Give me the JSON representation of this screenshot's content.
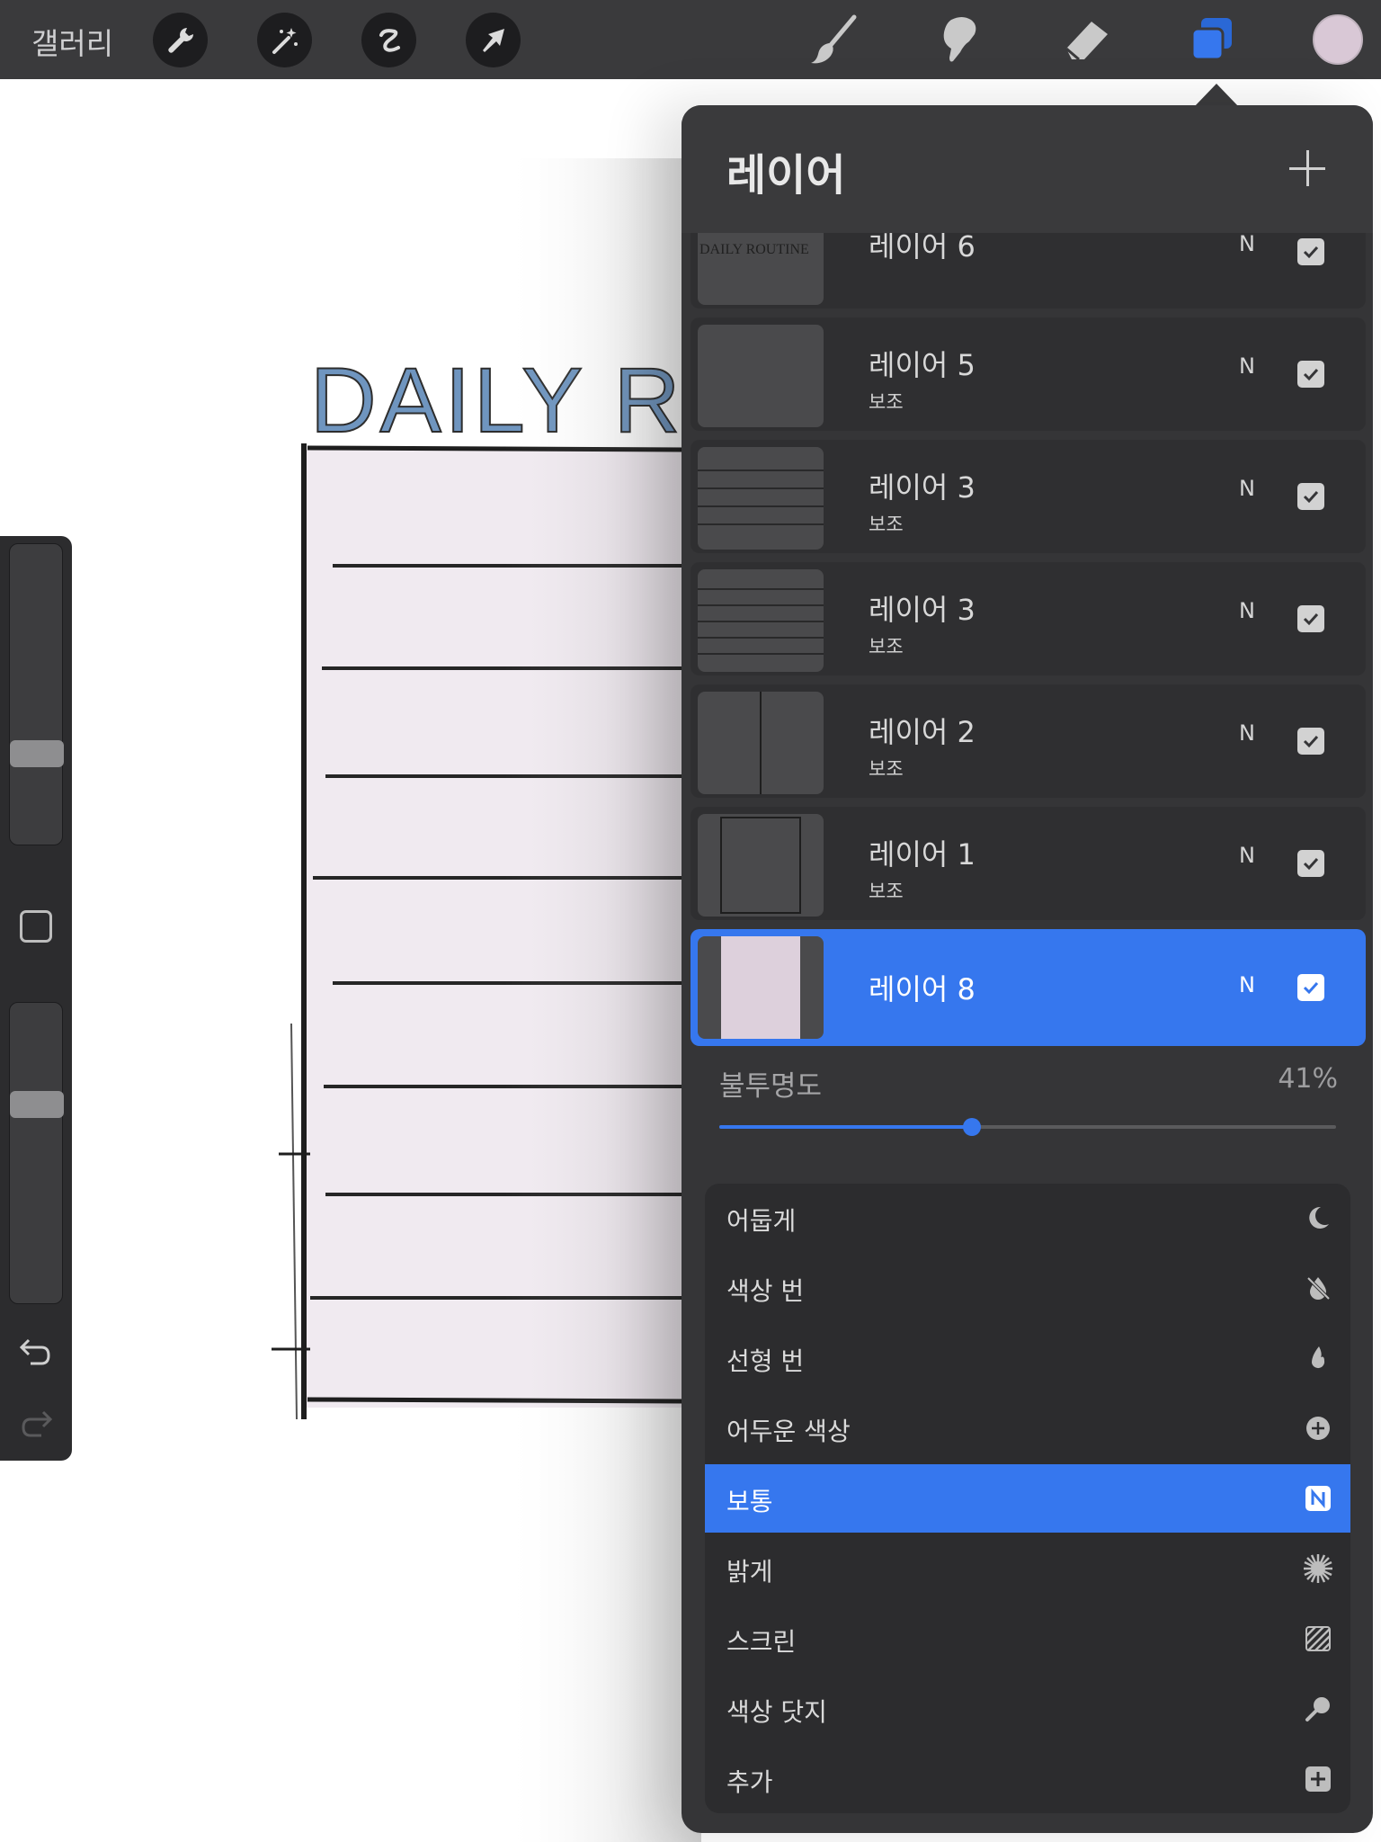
{
  "toolbar": {
    "gallery_label": "갤러리",
    "left_tools": [
      "wrench-icon",
      "magic-wand-icon",
      "selection-icon",
      "transform-arrow-icon"
    ],
    "right_tools": [
      "brush-icon",
      "smudge-icon",
      "eraser-icon",
      "layers-icon"
    ],
    "color_swatch": "#d9c8d6",
    "accent_color": "#3677ee"
  },
  "canvas": {
    "title_text": "DAILY RO"
  },
  "layers_panel": {
    "title": "레이어",
    "layers": [
      {
        "name": "레이어 6",
        "sub": "",
        "mode": "N",
        "visible": true,
        "thumb_text": "DAILY ROUTINE"
      },
      {
        "name": "레이어 5",
        "sub": "보조",
        "mode": "N",
        "visible": true
      },
      {
        "name": "레이어 3",
        "sub": "보조",
        "mode": "N",
        "visible": true
      },
      {
        "name": "레이어 3",
        "sub": "보조",
        "mode": "N",
        "visible": true
      },
      {
        "name": "레이어 2",
        "sub": "보조",
        "mode": "N",
        "visible": true
      },
      {
        "name": "레이어 1",
        "sub": "보조",
        "mode": "N",
        "visible": true
      },
      {
        "name": "레이어 8",
        "sub": "",
        "mode": "N",
        "visible": true,
        "selected": true
      }
    ],
    "opacity": {
      "label": "불투명도",
      "value_text": "41%",
      "value": 0.41
    },
    "blend_modes": [
      {
        "label": "어둡게",
        "icon": "moon-icon"
      },
      {
        "label": "색상 번",
        "icon": "burn-icon"
      },
      {
        "label": "선형 번",
        "icon": "flame-icon"
      },
      {
        "label": "어두운 색상",
        "icon": "plus-circle-icon"
      },
      {
        "label": "보통",
        "icon": "normal-n-icon",
        "active": true
      },
      {
        "label": "밝게",
        "icon": "sun-burst-icon"
      },
      {
        "label": "스크린",
        "icon": "hatch-icon"
      },
      {
        "label": "색상 닷지",
        "icon": "dodge-icon"
      },
      {
        "label": "추가",
        "icon": "add-square-icon"
      }
    ]
  }
}
